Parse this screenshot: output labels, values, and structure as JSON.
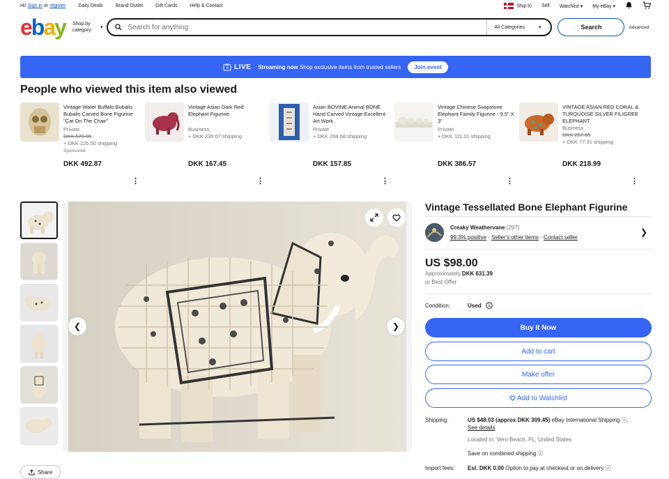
{
  "topbar": {
    "greeting": "Hi!",
    "signin": "Sign in",
    "or": "or",
    "register": "register",
    "links": [
      "Daily Deals",
      "Brand Outlet",
      "Gift Cards",
      "Help & Contact"
    ],
    "ship_to": "Ship to",
    "sell": "Sell",
    "watchlist": "Watchlist",
    "my_ebay": "My eBay"
  },
  "header": {
    "shop_by": "Shop by category",
    "search_placeholder": "Search for anything",
    "category": "All Categories",
    "search_btn": "Search",
    "advanced": "Advanced"
  },
  "banner": {
    "live": "LIVE",
    "streaming": "Streaming now",
    "text": "Shop exclusive items from trusted sellers",
    "join": "Join event"
  },
  "pv": {
    "heading": "People who viewed this item also viewed",
    "items": [
      {
        "title": "Vintage Water Buffalo Bubalis Bubalis Carved Bone Figurine \"Cat On The Chair\"",
        "condition": "Private",
        "price": "DKK 492.87",
        "orig": "DKK 579.85",
        "shipping": "+ DKK 225.50 shipping",
        "sponsored": "Sponsored"
      },
      {
        "title": "Vintage Asian Dark Red Elephant Figurine",
        "condition": "Business",
        "price": "DKK 167.45",
        "orig": "",
        "shipping": "+ DKK 230.07 shipping",
        "sponsored": ""
      },
      {
        "title": "Asian BOVINE Animal BONE Hand Carved Vintage Excellent Art Work",
        "condition": "Private",
        "price": "DKK 157.85",
        "orig": "",
        "shipping": "+ DKK 208.68 shipping",
        "sponsored": ""
      },
      {
        "title": "Vintage Chinese Soapstone Elephant Family Figurine - 9.5\" X 3\"",
        "condition": "Private",
        "price": "DKK 386.57",
        "orig": "",
        "shipping": "+ DKK 111.01 shipping",
        "sponsored": ""
      },
      {
        "title": "VINTAGE ASIAN RED CORAL & TURQUOISE SILVER FILIGREE ELEPHANT",
        "condition": "Business",
        "price": "DKK 218.99",
        "orig": "DKK 257.65",
        "shipping": "+ DKK 77.31 shipping",
        "sponsored": ""
      }
    ]
  },
  "gallery": {
    "share": "Share"
  },
  "listing": {
    "title": "Vintage Tessellated Bone Elephant Figurine",
    "seller_name": "Creaky Weathervane",
    "seller_count": "(297)",
    "positive": "99.3% positive",
    "other_items": "Seller's other items",
    "contact": "Contact seller",
    "price": "US $98.00",
    "approx_label": "Approximately",
    "approx_value": "DKK 631.39",
    "obo": "or Best Offer",
    "condition_label": "Condition:",
    "condition_value": "Used",
    "buy_now": "Buy It Now",
    "add_cart": "Add to cart",
    "make_offer": "Make offer",
    "watchlist": "Add to Watchlist",
    "shipping_label": "Shipping:",
    "shipping_value": "US $48.03 (approx DKK 309.45)",
    "shipping_method": "eBay International Shipping",
    "see_details": "See details",
    "located": "Located in: Vero Beach, FL, United States",
    "combined": "Save on combined shipping",
    "import_label": "Import fees:",
    "import_value": "Est. DKK 0.00",
    "import_note": "Option to pay at checkout or on delivery"
  }
}
